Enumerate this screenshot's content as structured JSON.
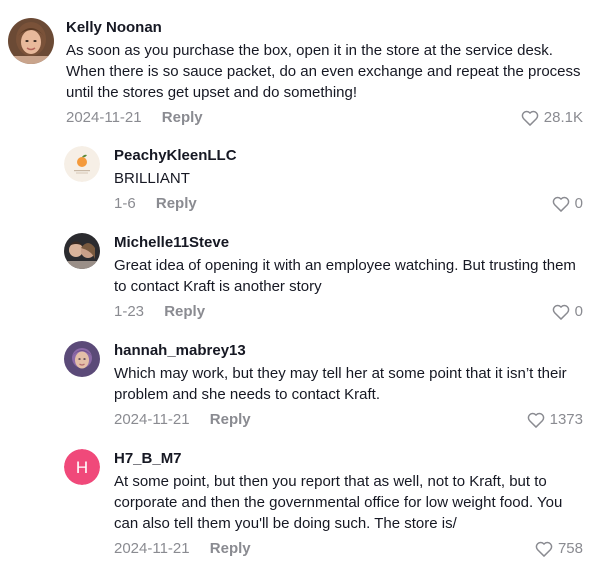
{
  "comments": [
    {
      "username": "Kelly Noonan",
      "text": "As soon as you purchase the box, open it in the store at the service desk. When there is so sauce packet, do an even exchange and repeat the process until the stores get upset and do something!",
      "date": "2024-11-21",
      "reply_label": "Reply",
      "likes": "28.1K",
      "avatar": "profile-photo-woman-brown-hair"
    },
    {
      "username": "PeachyKleenLLC",
      "text": "BRILLIANT",
      "date": "1-6",
      "reply_label": "Reply",
      "likes": "0",
      "avatar": "peach-logo"
    },
    {
      "username": "Michelle11Steve",
      "text": "Great idea of opening it with an employee watching. But trusting them to contact Kraft is another story",
      "date": "1-23",
      "reply_label": "Reply",
      "likes": "0",
      "avatar": "profile-photo-couple"
    },
    {
      "username": "hannah_mabrey13",
      "text": "Which may work, but they may tell her at some point that it isn’t their problem and she needs to contact Kraft.",
      "date": "2024-11-21",
      "reply_label": "Reply",
      "likes": "1373",
      "avatar": "profile-photo-woman-purple"
    },
    {
      "username": "H7_B_M7",
      "text": "At some point, but then you report that as well, not to Kraft, but to corporate and then the governmental office for low weight food. You can also tell them you'll be doing such. The store is/",
      "date": "2024-11-21",
      "reply_label": "Reply",
      "likes": "758",
      "avatar": "letter-avatar",
      "avatar_letter": "H",
      "avatar_color": "#f0497a"
    }
  ],
  "icons": {
    "like": "heart-outline-icon"
  },
  "colors": {
    "text": "#161823",
    "muted": "#8a8b91"
  }
}
